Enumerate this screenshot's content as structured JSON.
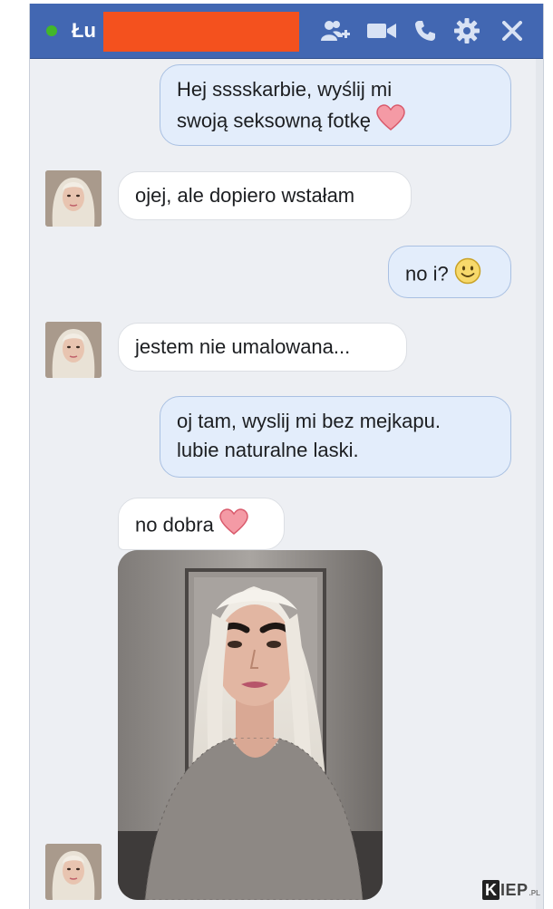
{
  "header": {
    "contact_name": "Łu",
    "online": true,
    "background_color": "#4267b2",
    "icons": [
      "add-people-icon",
      "video-call-icon",
      "phone-icon",
      "settings-gear-icon",
      "close-icon"
    ]
  },
  "messages": [
    {
      "direction": "outgoing",
      "lines": [
        "Hej sssskarbie, wyślij mi",
        "swoją seksowną fotkę"
      ],
      "emoji": "heart"
    },
    {
      "direction": "incoming",
      "text": "ojej, ale dopiero wstałam"
    },
    {
      "direction": "outgoing",
      "text": "no i?",
      "emoji": "smiley"
    },
    {
      "direction": "incoming",
      "text": "jestem nie umalowana..."
    },
    {
      "direction": "outgoing",
      "lines": [
        "oj tam, wyslij mi bez mejkapu.",
        "lubie naturalne laski."
      ]
    },
    {
      "direction": "incoming",
      "text": "no dobra",
      "emoji": "heart"
    },
    {
      "direction": "incoming",
      "type": "photo"
    }
  ],
  "watermark": {
    "k": "K",
    "rest": "IEP",
    "suffix": ".PL"
  },
  "colors": {
    "chat_background": "#edeff3",
    "outgoing_bubble": "#e3edfb",
    "incoming_bubble": "#ffffff",
    "heart": "#f28b9a"
  }
}
